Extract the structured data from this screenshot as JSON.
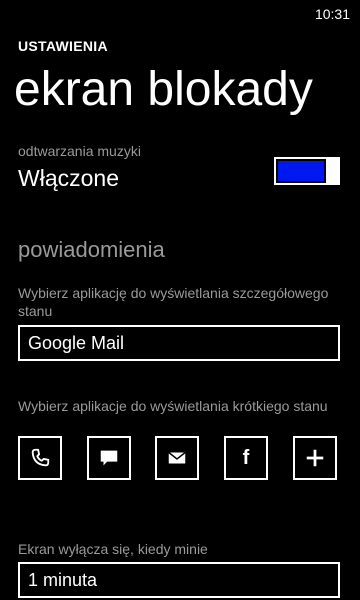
{
  "status_bar": {
    "time": "10:31"
  },
  "header": {
    "app_title": "USTAWIENIA",
    "page_title": "ekran blokady"
  },
  "music": {
    "label": "odtwarzania muzyki",
    "value": "Włączone",
    "toggle_on": true,
    "accent_color": "#0018f0"
  },
  "notifications": {
    "section_title": "powiadomienia",
    "detailed_label": "Wybierz aplikację do wyświetlania szczegółowego stanu",
    "detailed_value": "Google Mail",
    "quick_label": "Wybierz aplikacje do wyświetlania krótkiego stanu",
    "quick_icons": [
      "phone-icon",
      "messaging-icon",
      "mail-icon",
      "facebook-icon",
      "add-icon"
    ],
    "facebook_glyph": "f"
  },
  "screen_timeout": {
    "label": "Ekran wyłącza się, kiedy minie",
    "value": "1 minuta"
  }
}
